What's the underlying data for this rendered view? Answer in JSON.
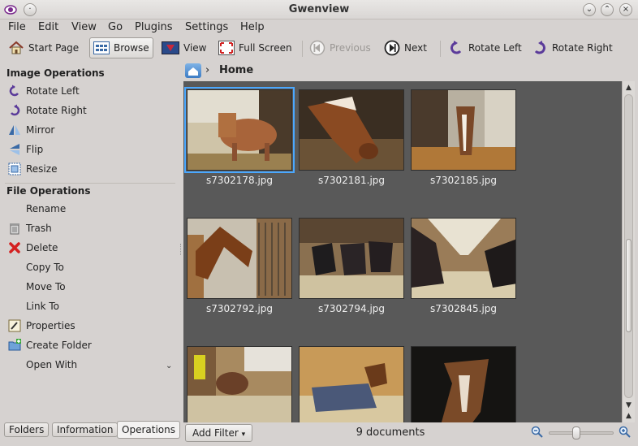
{
  "window": {
    "title": "Gwenview"
  },
  "menu": [
    "File",
    "Edit",
    "View",
    "Go",
    "Plugins",
    "Settings",
    "Help"
  ],
  "toolbar": {
    "start_page": "Start Page",
    "browse": "Browse",
    "view": "View",
    "full_screen": "Full Screen",
    "previous": "Previous",
    "next": "Next",
    "rotate_left": "Rotate Left",
    "rotate_right": "Rotate Right"
  },
  "sidebar": {
    "image_ops_title": "Image Operations",
    "image_ops": [
      {
        "label": "Rotate Left",
        "icon": "rotate-left-icon"
      },
      {
        "label": "Rotate Right",
        "icon": "rotate-right-icon"
      },
      {
        "label": "Mirror",
        "icon": "mirror-icon"
      },
      {
        "label": "Flip",
        "icon": "flip-icon"
      },
      {
        "label": "Resize",
        "icon": "resize-icon"
      }
    ],
    "file_ops_title": "File Operations",
    "file_ops": [
      {
        "label": "Rename",
        "icon": ""
      },
      {
        "label": "Trash",
        "icon": "trash-icon"
      },
      {
        "label": "Delete",
        "icon": "delete-icon"
      },
      {
        "label": "Copy To",
        "icon": ""
      },
      {
        "label": "Move To",
        "icon": ""
      },
      {
        "label": "Link To",
        "icon": ""
      },
      {
        "label": "Properties",
        "icon": "properties-icon"
      },
      {
        "label": "Create Folder",
        "icon": "folder-new-icon"
      },
      {
        "label": "Open With",
        "icon": ""
      }
    ],
    "tabs": [
      "Folders",
      "Information",
      "Operations"
    ],
    "active_tab": "Operations"
  },
  "breadcrumb": {
    "location": "Home"
  },
  "thumbnails": [
    {
      "name": "s7302178.jpg",
      "selected": true
    },
    {
      "name": "s7302181.jpg",
      "selected": false
    },
    {
      "name": "s7302185.jpg",
      "selected": false
    },
    {
      "name": "s7302792.jpg",
      "selected": false
    },
    {
      "name": "s7302794.jpg",
      "selected": false
    },
    {
      "name": "s7302845.jpg",
      "selected": false
    },
    {
      "name": "",
      "selected": false
    },
    {
      "name": "",
      "selected": false
    },
    {
      "name": "",
      "selected": false
    }
  ],
  "status": {
    "add_filter": "Add Filter",
    "document_count": "9 documents"
  },
  "zoom": {
    "level": 0.4
  },
  "scroll": {
    "position": 0.69,
    "visible_fraction": 0.31
  },
  "colors": {
    "grid_bg": "#595959",
    "selection": "#4aa8ff",
    "window_bg": "#d6d2d0"
  }
}
